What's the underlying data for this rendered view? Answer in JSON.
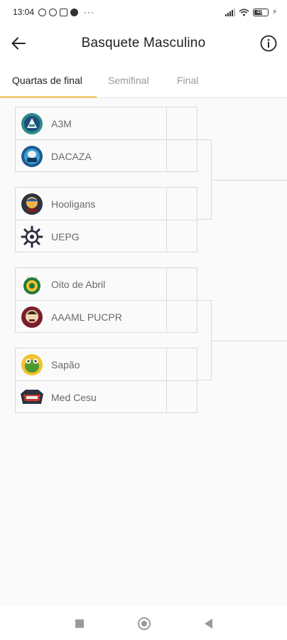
{
  "status_bar": {
    "time": "13:04",
    "more": "···",
    "battery": "48"
  },
  "header": {
    "title": "Basquete Masculino",
    "back_icon": "arrow-left-icon",
    "info_icon": "info-icon"
  },
  "tabs": [
    {
      "label": "Quartas de final",
      "active": true
    },
    {
      "label": "Semifinal",
      "active": false
    },
    {
      "label": "Final",
      "active": false
    }
  ],
  "matches": [
    {
      "teams": [
        {
          "name": "A3M",
          "logo": "a3m-logo",
          "score": ""
        },
        {
          "name": "DACAZA",
          "logo": "dacaza-logo",
          "score": ""
        }
      ]
    },
    {
      "teams": [
        {
          "name": "Hooligans",
          "logo": "hooligans-logo",
          "score": ""
        },
        {
          "name": "UEPG",
          "logo": "uepg-logo",
          "score": ""
        }
      ]
    },
    {
      "teams": [
        {
          "name": "Oito de Abril",
          "logo": "oito-de-abril-logo",
          "score": ""
        },
        {
          "name": "AAAML PUCPR",
          "logo": "aaaml-pucpr-logo",
          "score": ""
        }
      ]
    },
    {
      "teams": [
        {
          "name": "Sapão",
          "logo": "sapao-logo",
          "score": ""
        },
        {
          "name": "Med Cesu",
          "logo": "med-cesu-logo",
          "score": ""
        }
      ]
    }
  ],
  "colors": {
    "accent": "#f0ca7a",
    "border": "#d9d9d9",
    "text_muted": "#6a6a6a"
  },
  "nav_bar": {
    "icons": [
      "recents-icon",
      "home-icon",
      "back-icon"
    ]
  }
}
